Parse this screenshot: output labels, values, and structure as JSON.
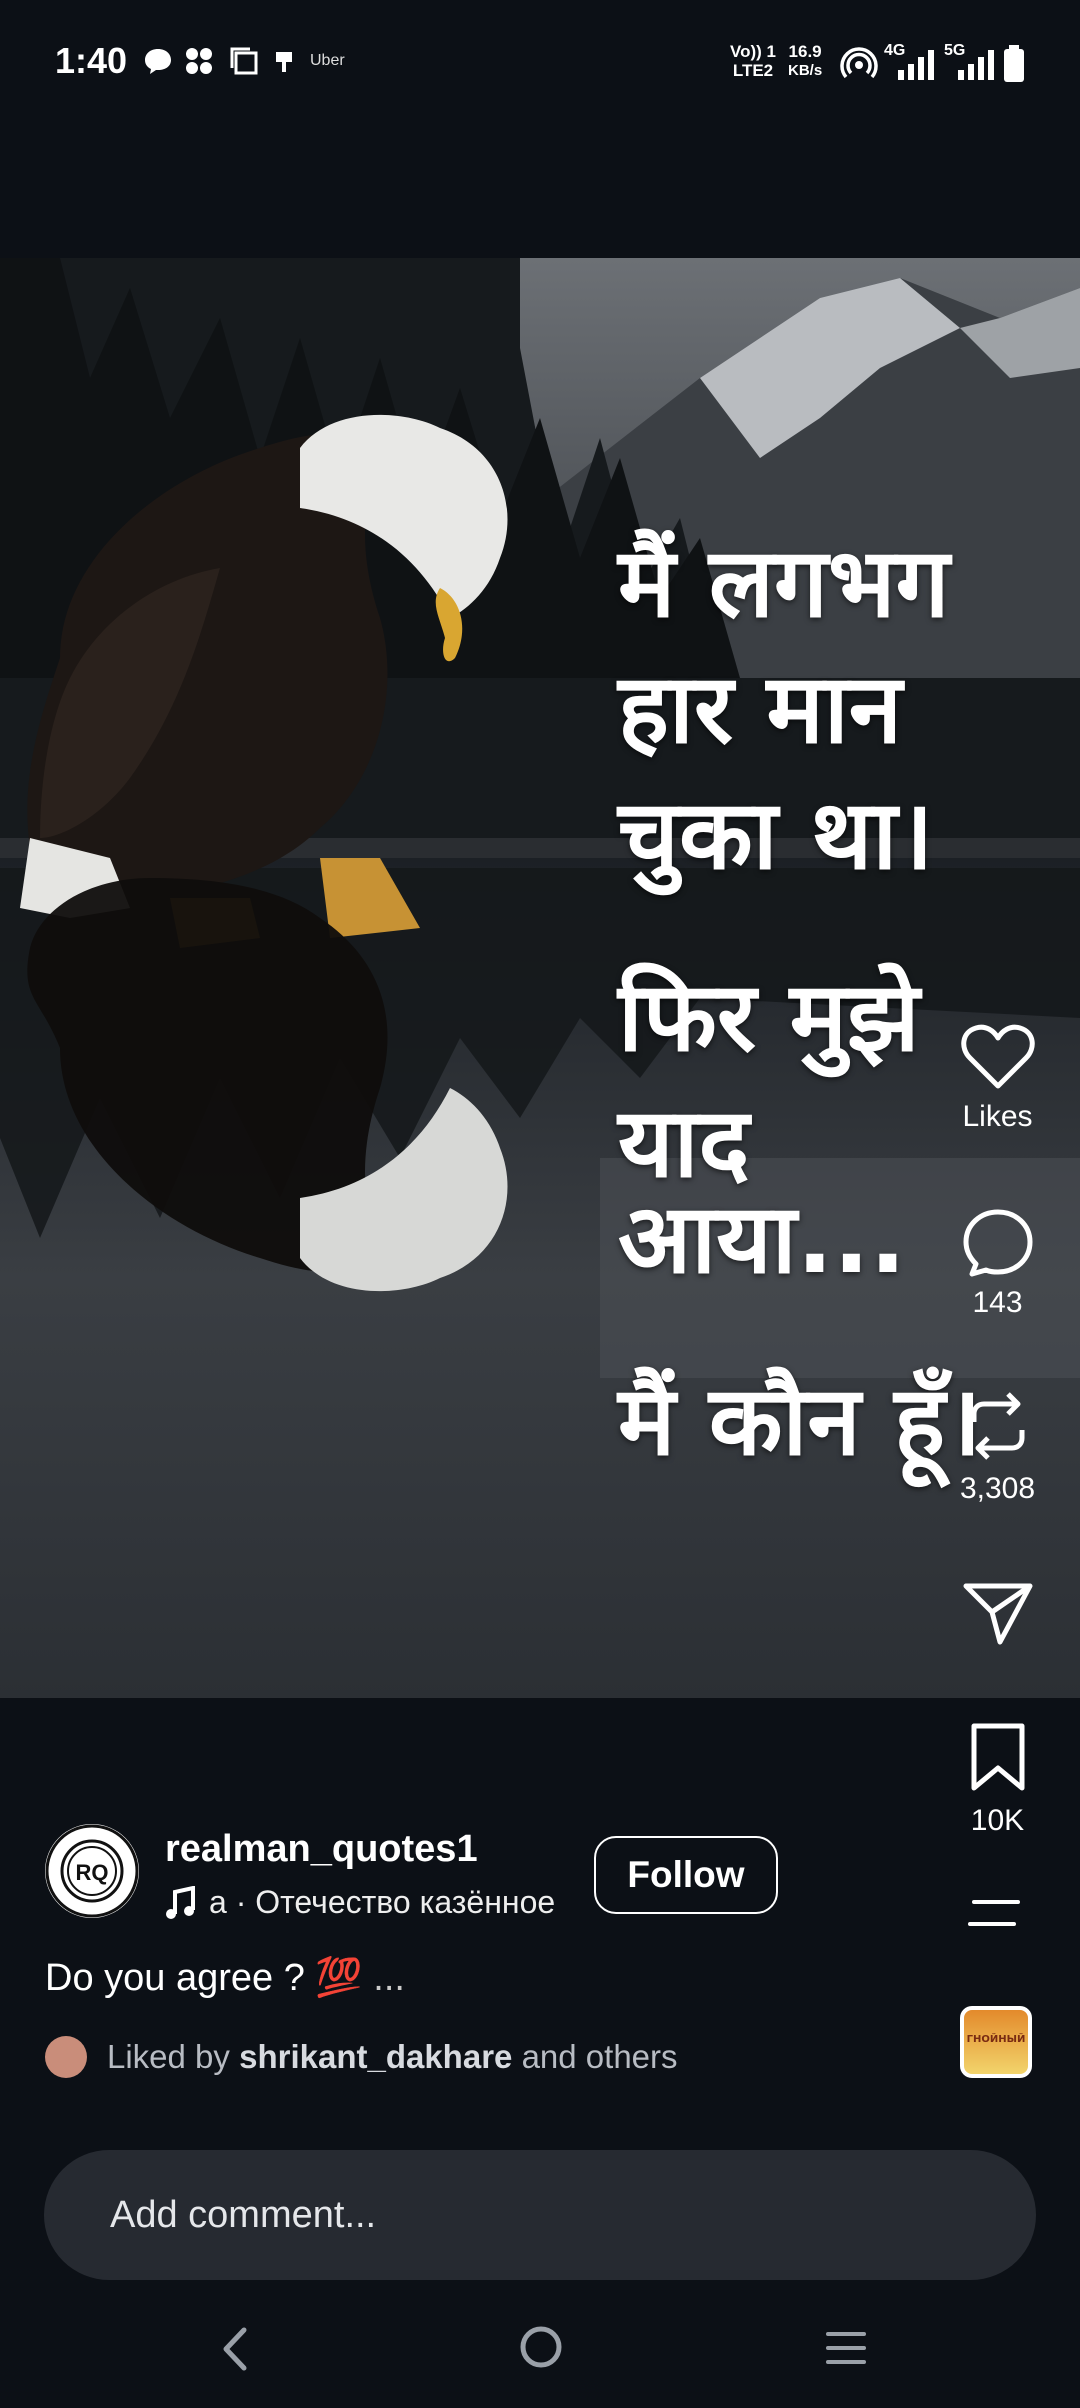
{
  "status_bar": {
    "time": "1:40",
    "uber_label": "Uber",
    "volte_line1": "Vo)) 1",
    "volte_line2": "LTE2",
    "speed_value": "16.9",
    "speed_unit": "KB/s",
    "sim1_type": "4G",
    "sim2_type": "5G",
    "icons": [
      "chat-bubble-icon",
      "pinwheel-icon",
      "copy-icon",
      "charging-plug-icon",
      "hotspot-icon",
      "signal-icon",
      "battery-icon"
    ]
  },
  "post": {
    "overlay_lines": [
      "मैं लगभग",
      "हार मान",
      "चुका था।",
      "फिर मुझे",
      "याद आया...",
      "मैं कौन हूँ।"
    ],
    "actions": {
      "likes_label": "Likes",
      "comments_count": "143",
      "reposts_count": "3,308",
      "saves_count": "10K"
    },
    "author": {
      "username": "realman_quotes1",
      "avatar_text": "RQ",
      "avatar_ring_text": "REALMAN QUOTES1",
      "audio_text": "а · Отечество казённое",
      "follow_label": "Follow"
    },
    "caption": "Do you agree ? 💯",
    "caption_more": "...",
    "liked_by": {
      "prefix": "Liked by",
      "user": "shrikant_dakhare",
      "suffix": "and others"
    },
    "audio_thumb_text": "ГНОЙНЫЙ"
  },
  "comment": {
    "placeholder": "Add comment..."
  },
  "colors": {
    "background": "#0c1016",
    "comment_box": "#262a31",
    "text_secondary": "#b8bcc3"
  }
}
